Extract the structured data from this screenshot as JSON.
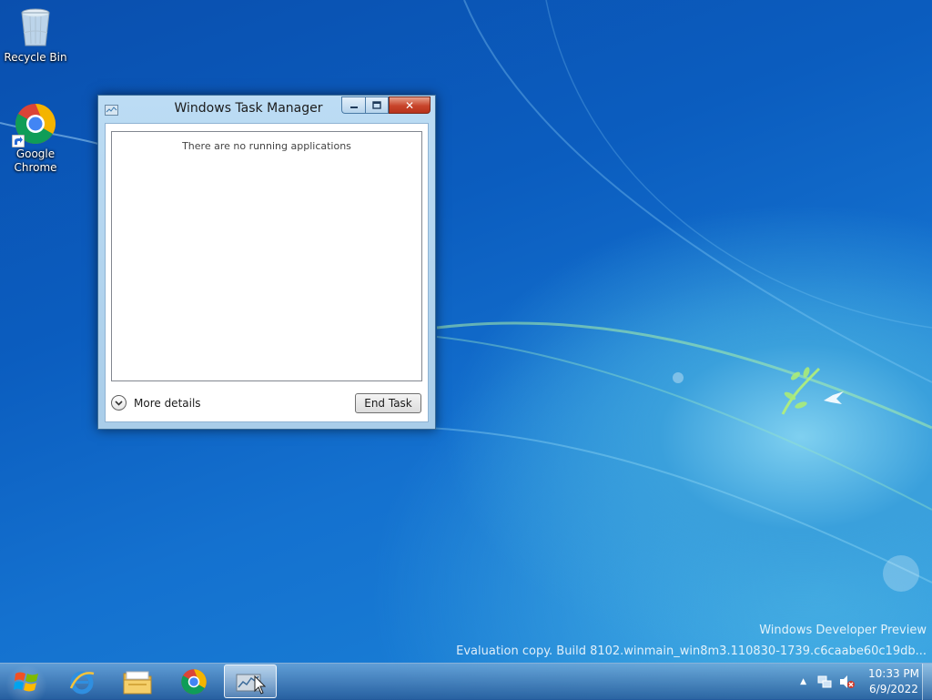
{
  "desktop": {
    "icons": [
      {
        "label": "Recycle Bin",
        "icon": "recycle-bin-icon"
      },
      {
        "label": "Google Chrome",
        "icon": "chrome-icon"
      }
    ],
    "watermark": {
      "line1": "Windows Developer Preview",
      "line2": "Evaluation copy. Build 8102.winmain_win8m3.110830-1739.c6caabe60c19db..."
    }
  },
  "window": {
    "title": "Windows Task Manager",
    "empty_message": "There are no running applications",
    "more_details_label": "More details",
    "end_task_label": "End Task",
    "close_glyph": "✕"
  },
  "taskbar": {
    "pinned": [
      {
        "name": "internet-explorer",
        "icon": "ie-icon"
      },
      {
        "name": "file-explorer",
        "icon": "folder-icon"
      },
      {
        "name": "google-chrome",
        "icon": "chrome-icon"
      },
      {
        "name": "task-manager",
        "icon": "task-manager-icon",
        "active": true
      }
    ],
    "clock": {
      "time": "10:33 PM",
      "date": "6/9/2022"
    },
    "tray_icons": [
      "show-hidden-icons-icon",
      "network-icon",
      "volume-muted-icon"
    ]
  },
  "colors": {
    "wallpaper": "#0b5dbf",
    "close_button": "#c7442a",
    "taskbar": "#3a78b8"
  }
}
